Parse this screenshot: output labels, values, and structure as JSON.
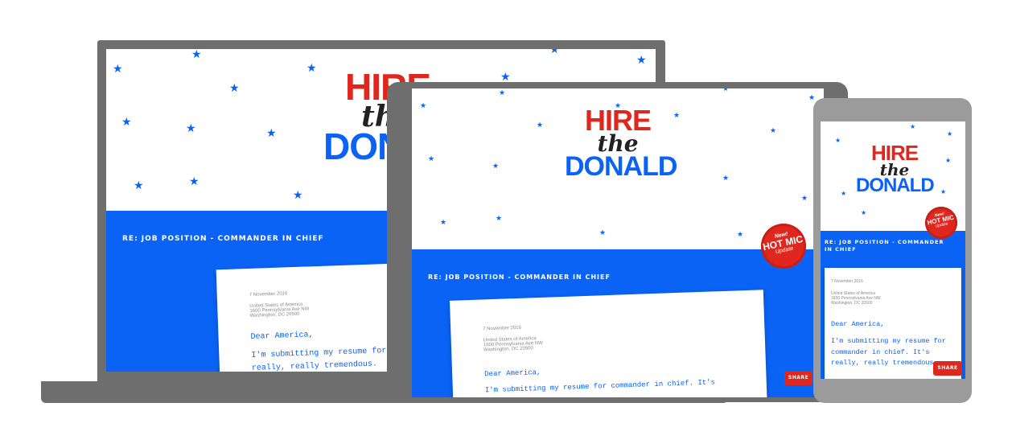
{
  "logo": {
    "hire": "HIRE",
    "the": "the",
    "donald": "DONALD"
  },
  "subject": "RE: JOB POSITION - COMMANDER IN CHIEF",
  "letter": {
    "date": "7 November 2016",
    "address_line1": "United States of America",
    "address_line2": "1600 Pennsylvania Ave NW",
    "address_line3": "Washington, DC 20500",
    "greeting": "Dear America,",
    "body_laptop": "I'm submitting my resume for commander in chief. It's really, really tremendous.",
    "body_tablet": "I'm submitting my resume for commander in chief. It's really,",
    "body_phone": "I'm submitting my resume for commander in chief. It's really, really tremendous."
  },
  "share_label": "SHARE",
  "badge": {
    "new": "New!",
    "hot": "HOT MIC",
    "update": "Update"
  },
  "colors": {
    "red": "#e0271e",
    "blue": "#0a63f5",
    "device_gray": "#6e6e6e",
    "phone_gray": "#9b9b9b"
  },
  "icons": {
    "star": "star-icon"
  }
}
